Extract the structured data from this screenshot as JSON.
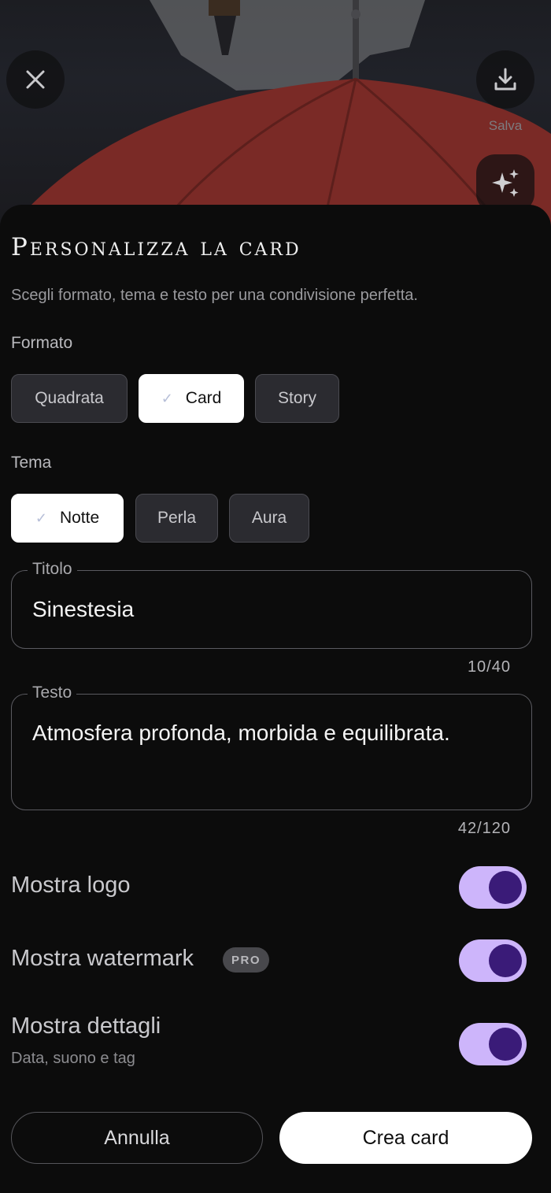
{
  "header": {
    "close_icon": "close-icon",
    "save_icon": "download-icon",
    "save_label": "Salva",
    "sparkle_icon": "sparkles-icon"
  },
  "sheet": {
    "title": "Personalizza la card",
    "subtitle": "Scegli formato, tema e testo per una condivisione perfetta."
  },
  "format": {
    "label": "Formato",
    "options": [
      "Quadrata",
      "Card",
      "Story"
    ],
    "selected": "Card"
  },
  "theme": {
    "label": "Tema",
    "options": [
      "Notte",
      "Perla",
      "Aura"
    ],
    "selected": "Notte"
  },
  "title_field": {
    "legend": "Titolo",
    "value": "Sinestesia",
    "counter": "10/40"
  },
  "text_field": {
    "legend": "Testo",
    "value": "Atmosfera profonda, morbida e equilibrata.",
    "counter": "42/120"
  },
  "toggles": {
    "logo": {
      "label": "Mostra logo",
      "on": true
    },
    "watermark": {
      "label": "Mostra watermark",
      "badge": "PRO",
      "on": true
    },
    "details": {
      "label": "Mostra dettagli",
      "sublabel": "Data, suono e tag",
      "on": true
    }
  },
  "actions": {
    "cancel": "Annulla",
    "create": "Crea card"
  },
  "colors": {
    "toggle_track": "#cdb5fb",
    "toggle_knob": "#3a1b78",
    "sheet_bg": "#0c0c0c"
  }
}
